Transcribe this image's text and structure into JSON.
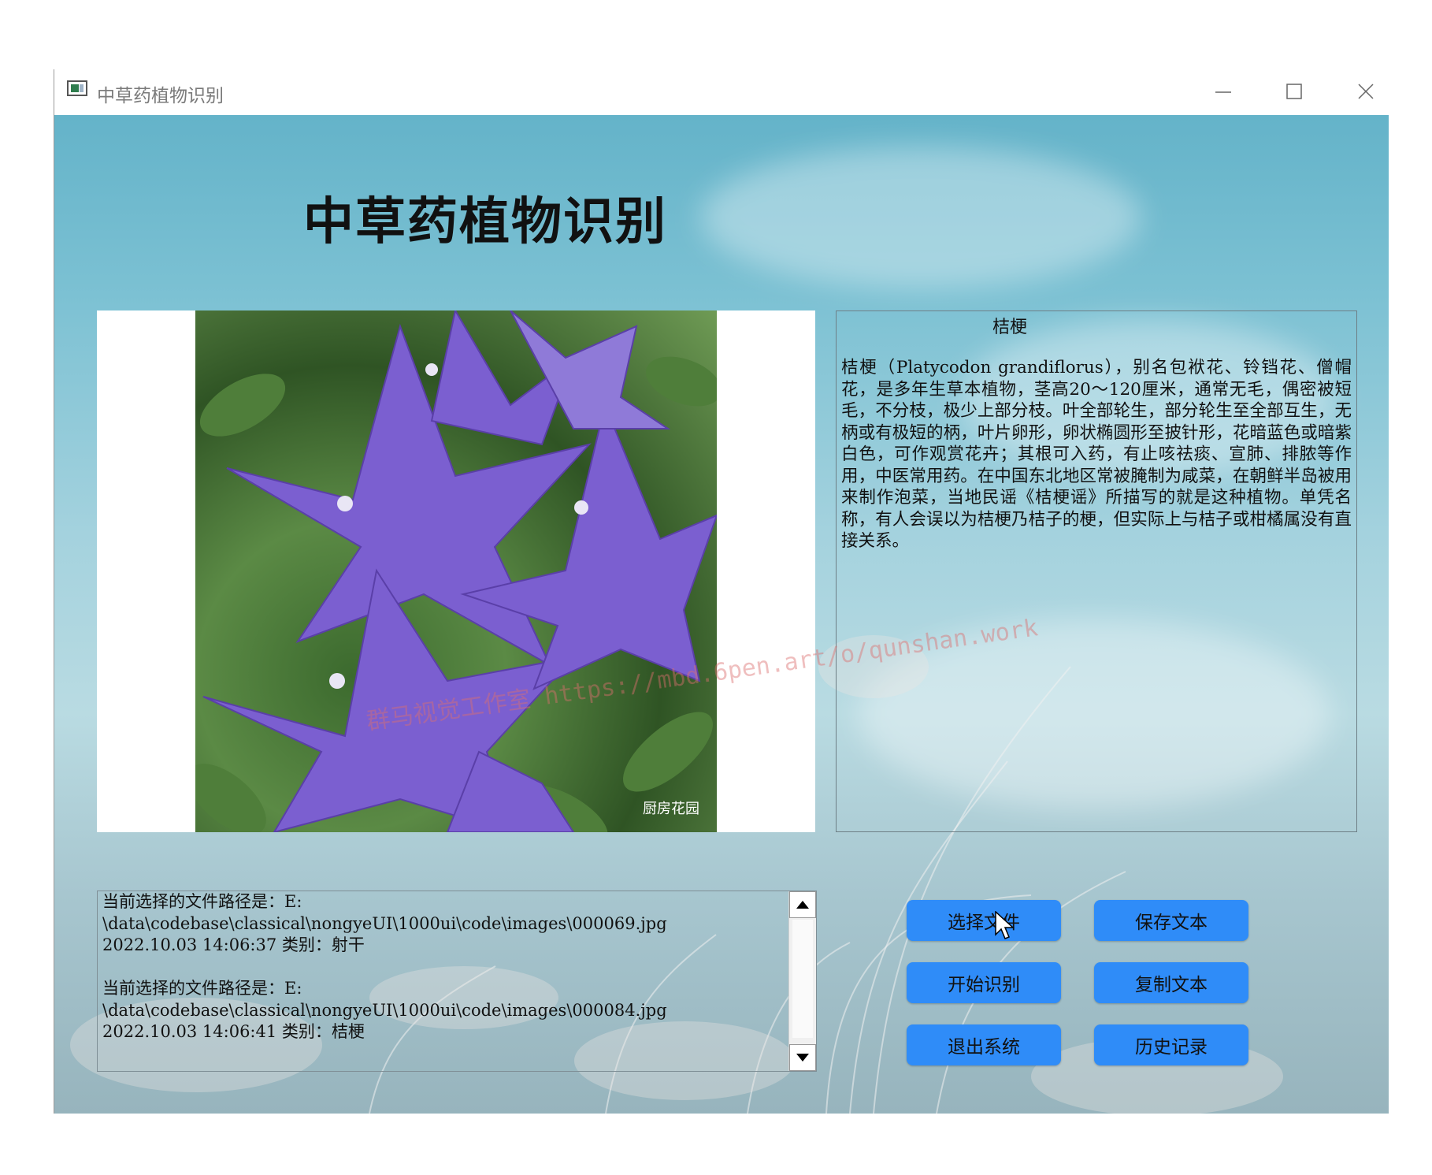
{
  "window": {
    "title": "中草药植物识别",
    "controls": {
      "minimize": "minimize-icon",
      "maximize": "maximize-icon",
      "close": "close-icon"
    }
  },
  "main": {
    "heading": "中草药植物识别",
    "image": {
      "caption_watermark": "厨房花园"
    },
    "overlay_watermark": "群马视觉工作室 https://mbd.6pen.art/o/qunshan.work",
    "info": {
      "title": "桔梗",
      "body": "桔梗（Platycodon grandiflorus），别名包袱花、铃铛花、僧帽花，是多年生草本植物，茎高20～120厘米，通常无毛，偶密被短毛，不分枝，极少上部分枝。叶全部轮生，部分轮生至全部互生，无柄或有极短的柄，叶片卵形，卵状椭圆形至披针形，花暗蓝色或暗紫白色，可作观赏花卉；其根可入药，有止咳祛痰、宣肺、排脓等作用，中医常用药。在中国东北地区常被腌制为咸菜，在朝鲜半岛被用来制作泡菜，当地民谣《桔梗谣》所描写的就是这种植物。单凭名称，有人会误以为桔梗乃桔子的梗，但实际上与桔子或柑橘属没有直接关系。"
    },
    "log": {
      "entries": [
        "当前选择的文件路径是：E:\n\\data\\codebase\\classical\\nongyeUI\\1000ui\\code\\images\\000069.jpg\n2022.10.03 14:06:37 类别：射干",
        "当前选择的文件路径是：E:\n\\data\\codebase\\classical\\nongyeUI\\1000ui\\code\\images\\000084.jpg\n2022.10.03 14:06:41 类别：桔梗"
      ]
    },
    "buttons": {
      "select_file": "选择文件",
      "save_text": "保存文本",
      "start_recognition": "开始识别",
      "copy_text": "复制文本",
      "exit_system": "退出系统",
      "history": "历史记录"
    }
  },
  "colors": {
    "button": "#2f8cf8",
    "flower": "#7b5fd0"
  }
}
